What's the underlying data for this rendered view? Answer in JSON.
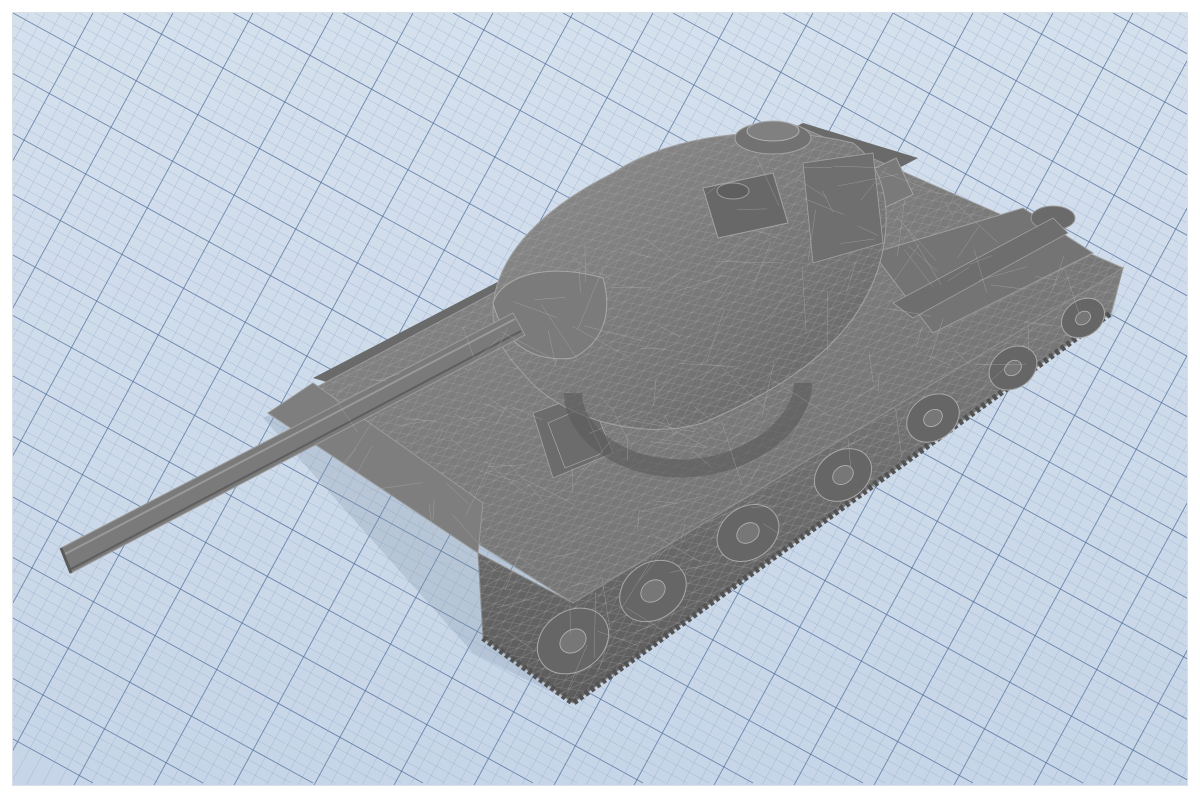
{
  "viewport": {
    "model": "tank-3d-model",
    "render_mode": "shaded-wireframe",
    "colors": {
      "ground": "#cfdceb",
      "grid_minor": "#8aa3c4",
      "grid_major": "#4e6d98",
      "model_fill": "#7a7a7a",
      "model_dark": "#5f5f5f",
      "model_light": "#8f8f8f",
      "wire": "#b4b4b4"
    },
    "icons": []
  }
}
